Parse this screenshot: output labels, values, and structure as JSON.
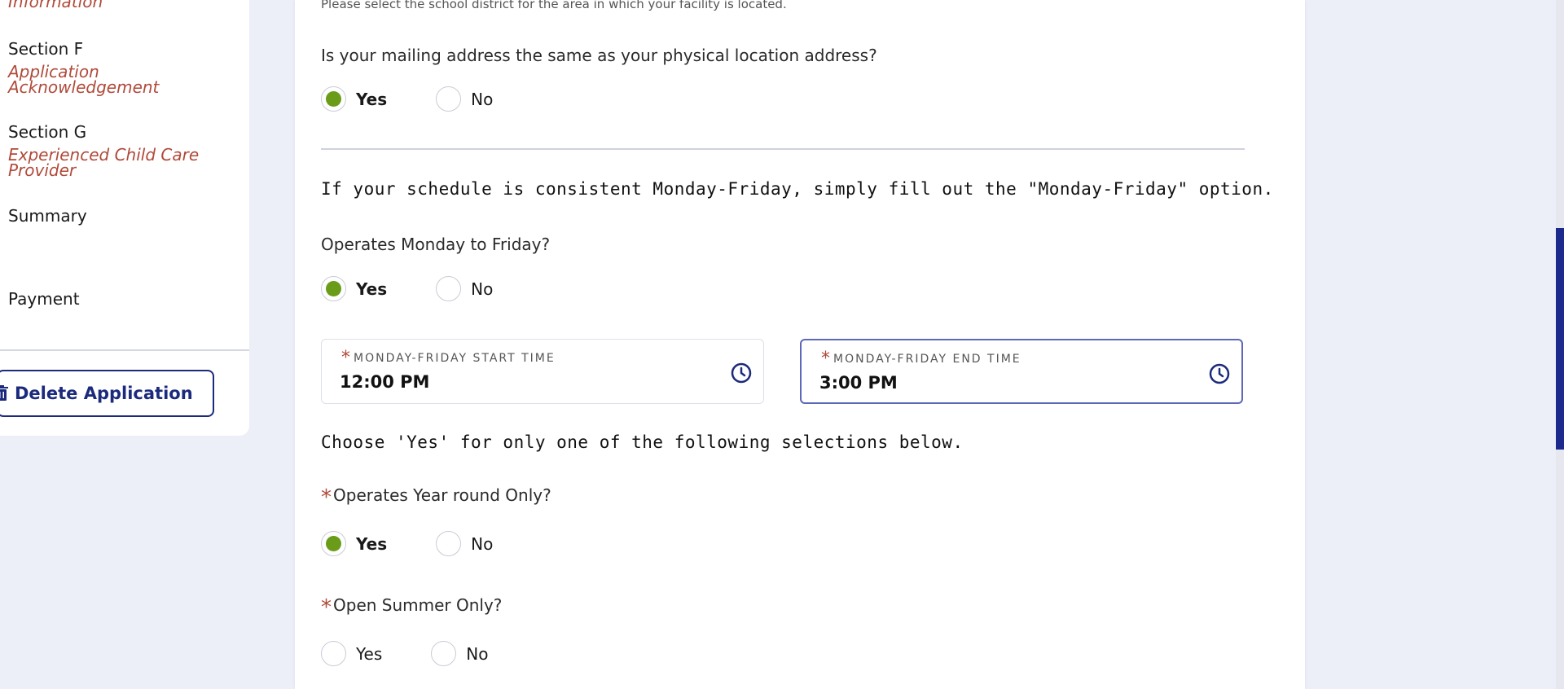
{
  "sidebar": {
    "prev_sub_label": "Information",
    "section_f": {
      "label": "Section F",
      "sub": [
        "Application",
        "Acknowledgement"
      ]
    },
    "section_g": {
      "label": "Section G",
      "sub": [
        "Experienced Child Care",
        "Provider"
      ]
    },
    "summary_label": "Summary",
    "payment_label": "Payment",
    "delete_button_label": "Delete Application",
    "delete_icon": "trash-icon"
  },
  "main": {
    "school_district_help": "Please select the school district for the area in which your facility is located.",
    "mailing_question": "Is your mailing address the same as your physical location address?",
    "mailing_options": {
      "yes": "Yes",
      "no": "No",
      "selected": "Yes"
    },
    "schedule_instruction": "If your schedule is consistent Monday-Friday, simply fill out the \"Monday-Friday\" option.",
    "operates_mf_question": "Operates Monday to Friday?",
    "operates_mf_options": {
      "yes": "Yes",
      "no": "No",
      "selected": "Yes"
    },
    "start_time": {
      "label": "MONDAY-FRIDAY START TIME",
      "value": "12:00 PM"
    },
    "end_time": {
      "label": "MONDAY-FRIDAY END TIME",
      "value": "3:00 PM"
    },
    "choose_instruction": "Choose 'Yes' for only one of the following selections below.",
    "year_round_question": "Operates Year round Only?",
    "year_round_options": {
      "yes": "Yes",
      "no": "No",
      "selected": "Yes"
    },
    "summer_question": "Open Summer Only?",
    "summer_options": {
      "yes": "Yes",
      "no": "No",
      "selected": ""
    },
    "required_mark": "*"
  },
  "colors": {
    "accent": "#1b2a7c",
    "radio_checked": "#6a9c1a",
    "required": "#b04a3a",
    "sidebar_sub": "#b04a3a"
  }
}
